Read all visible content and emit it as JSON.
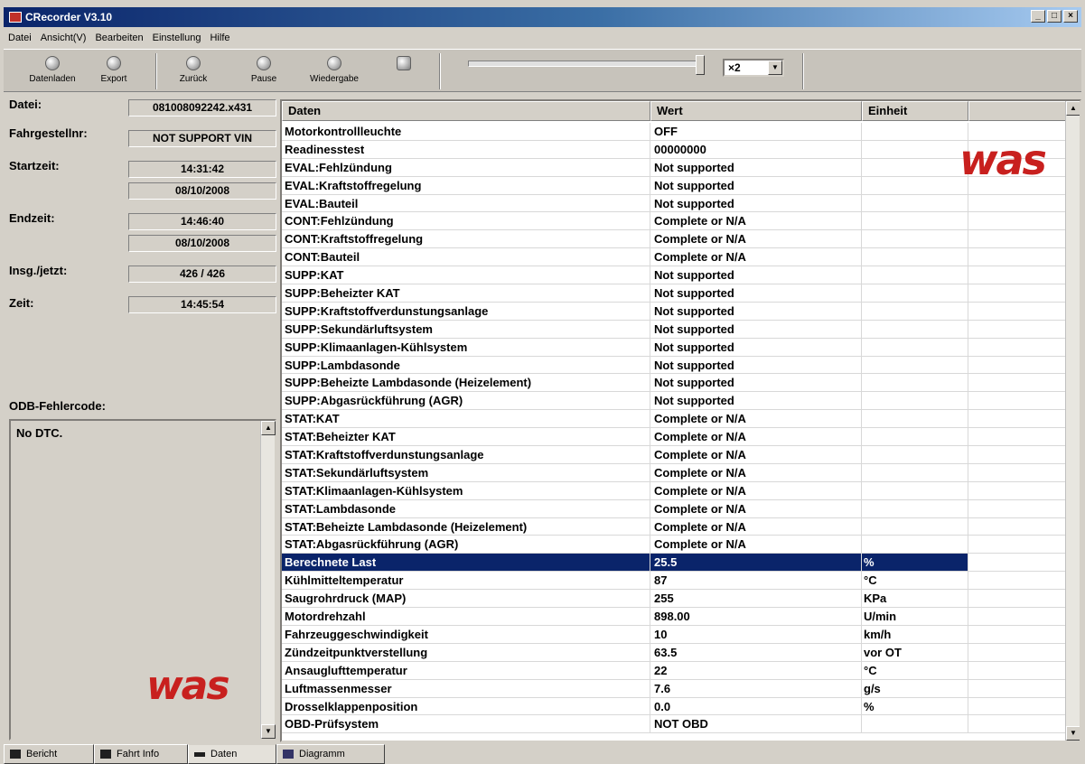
{
  "window": {
    "title": "CRecorder V3.10",
    "controls": [
      "_",
      "□",
      "×"
    ]
  },
  "menu": [
    "Datei",
    "Ansicht(V)",
    "Bearbeiten",
    "Einstellung",
    "Hilfe"
  ],
  "toolbar": {
    "buttons": [
      {
        "label": "Datenladen",
        "icon": "load-icon"
      },
      {
        "label": "Export",
        "icon": "export-icon"
      },
      {
        "label": "Zurück",
        "icon": "back-icon"
      },
      {
        "label": "Pause",
        "icon": "pause-icon"
      },
      {
        "label": "Wiedergabe",
        "icon": "play-icon"
      }
    ],
    "speed": "×2"
  },
  "info": {
    "datei_label": "Datei:",
    "datei_value": "081008092242.x431",
    "fahrgestell_label": "Fahrgestellnr:",
    "fahrgestell_value": "NOT SUPPORT VIN",
    "start_label": "Startzeit:",
    "start_time": "14:31:42",
    "start_date": "08/10/2008",
    "end_label": "Endzeit:",
    "end_time": "14:46:40",
    "end_date": "08/10/2008",
    "insg_label": "Insg./jetzt:",
    "insg_value": "426 / 426",
    "zeit_label": "Zeit:",
    "zeit_value": "14:45:54",
    "dtc_label": "ODB-Fehlercode:",
    "dtc_value": "No DTC."
  },
  "table": {
    "headers": [
      "Daten",
      "Wert",
      "Einheit",
      ""
    ],
    "rows": [
      [
        "Motorkontrollleuchte",
        "OFF",
        ""
      ],
      [
        "Readinesstest",
        "00000000",
        ""
      ],
      [
        "EVAL:Fehlzündung",
        "Not supported",
        ""
      ],
      [
        "EVAL:Kraftstoffregelung",
        "Not supported",
        ""
      ],
      [
        "EVAL:Bauteil",
        "Not supported",
        ""
      ],
      [
        "CONT:Fehlzündung",
        "Complete or N/A",
        ""
      ],
      [
        "CONT:Kraftstoffregelung",
        "Complete or N/A",
        ""
      ],
      [
        "CONT:Bauteil",
        "Complete or N/A",
        ""
      ],
      [
        "SUPP:KAT",
        "Not supported",
        ""
      ],
      [
        "SUPP:Beheizter KAT",
        "Not supported",
        ""
      ],
      [
        "SUPP:Kraftstoffverdunstungsanlage",
        "Not supported",
        ""
      ],
      [
        "SUPP:Sekundärluftsystem",
        "Not supported",
        ""
      ],
      [
        "SUPP:Klimaanlagen-Kühlsystem",
        "Not supported",
        ""
      ],
      [
        "SUPP:Lambdasonde",
        "Not supported",
        ""
      ],
      [
        "SUPP:Beheizte Lambdasonde (Heizelement)",
        "Not supported",
        ""
      ],
      [
        "SUPP:Abgasrückführung (AGR)",
        "Not supported",
        ""
      ],
      [
        "STAT:KAT",
        "Complete or N/A",
        ""
      ],
      [
        "STAT:Beheizter KAT",
        "Complete or N/A",
        ""
      ],
      [
        "STAT:Kraftstoffverdunstungsanlage",
        "Complete or N/A",
        ""
      ],
      [
        "STAT:Sekundärluftsystem",
        "Complete or N/A",
        ""
      ],
      [
        "STAT:Klimaanlagen-Kühlsystem",
        "Complete or N/A",
        ""
      ],
      [
        "STAT:Lambdasonde",
        "Complete or N/A",
        ""
      ],
      [
        "STAT:Beheizte Lambdasonde (Heizelement)",
        "Complete or N/A",
        ""
      ],
      [
        "STAT:Abgasrückführung (AGR)",
        "Complete or N/A",
        ""
      ],
      [
        "Berechnete Last",
        "25.5",
        "%"
      ],
      [
        "Kühlmitteltemperatur",
        "87",
        "°C"
      ],
      [
        "Saugrohrdruck (MAP)",
        "255",
        "KPa"
      ],
      [
        "Motordrehzahl",
        "898.00",
        "U/min"
      ],
      [
        "Fahrzeuggeschwindigkeit",
        "10",
        "km/h"
      ],
      [
        "Zündzeitpunktverstellung",
        "63.5",
        "vor OT"
      ],
      [
        "Ansauglufttemperatur",
        "22",
        "°C"
      ],
      [
        "Luftmassenmesser",
        "7.6",
        "g/s"
      ],
      [
        "Drosselklappenposition",
        "0.0",
        "%"
      ],
      [
        "OBD-Prüfsystem",
        "NOT OBD",
        ""
      ]
    ],
    "selected_index": 24
  },
  "tabs": [
    {
      "label": "Bericht",
      "active": false
    },
    {
      "label": "Fahrt Info",
      "active": false
    },
    {
      "label": "Daten",
      "active": true
    },
    {
      "label": "Diagramm",
      "active": false
    }
  ],
  "logo_text": "was",
  "colors": {
    "selection": "#0a246a",
    "logo": "#c8201e"
  }
}
